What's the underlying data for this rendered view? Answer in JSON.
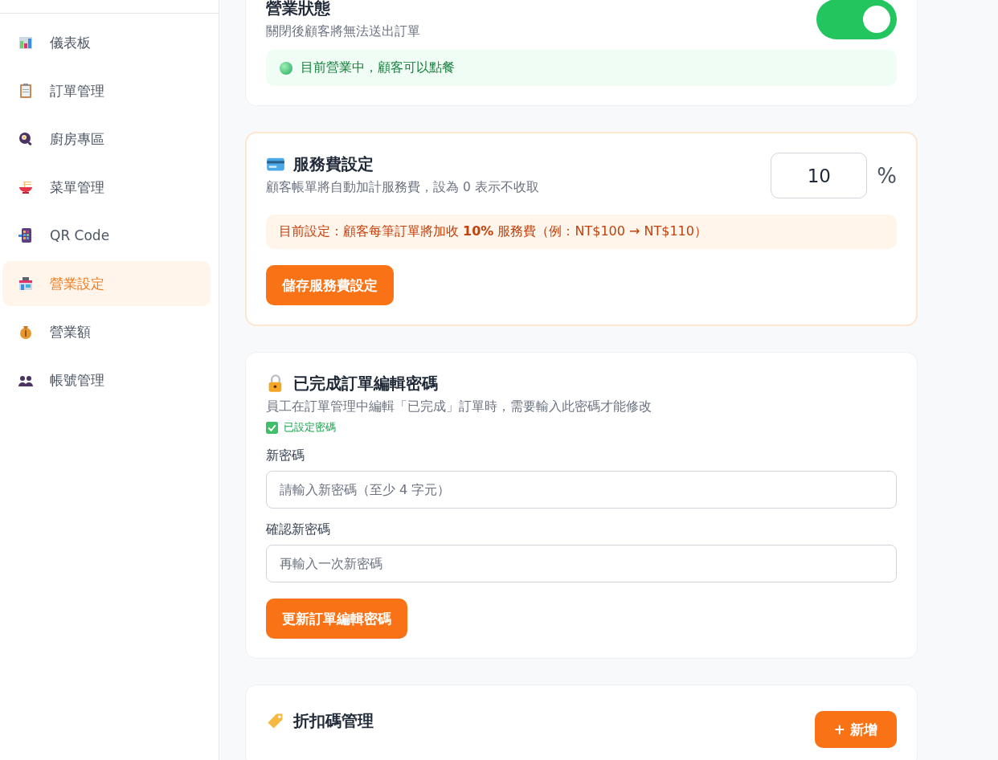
{
  "sidebar": {
    "items": [
      {
        "label": "儀表板",
        "selected": false
      },
      {
        "label": "訂單管理",
        "selected": false
      },
      {
        "label": "廚房專區",
        "selected": false
      },
      {
        "label": "菜單管理",
        "selected": false
      },
      {
        "label": "QR Code",
        "selected": false
      },
      {
        "label": "營業設定",
        "selected": true
      },
      {
        "label": "營業額",
        "selected": false
      },
      {
        "label": "帳號管理",
        "selected": false
      }
    ]
  },
  "business_status": {
    "title": "營業狀態",
    "subtitle": "關閉後顧客將無法送出訂單",
    "on": true,
    "status_text": "目前營業中，顧客可以點餐"
  },
  "service_fee": {
    "title": "服務費設定",
    "subtitle": "顧客帳單將自動加計服務費，設為 0 表示不收取",
    "value": "10",
    "unit": "%",
    "note": "目前設定：顧客每筆訂單將加收 **10%** 服務費（例：NT$100 → NT$110）",
    "button": "儲存服務費設定"
  },
  "edit_password": {
    "title": "已完成訂單編輯密碼",
    "subtitle": "員工在訂單管理中編輯「已完成」訂單時，需要輸入此密碼才能修改",
    "password_set": true,
    "set_text": "已設定密碼",
    "fields": [
      {
        "label": "新密碼",
        "placeholder": "請輸入新密碼（至少 4 字元）"
      },
      {
        "label": "確認新密碼",
        "placeholder": "再輸入一次新密碼"
      }
    ],
    "button": "更新訂單編輯密碼"
  },
  "discount_codes": {
    "title": "折扣碼管理",
    "button": "+ 新增"
  }
}
